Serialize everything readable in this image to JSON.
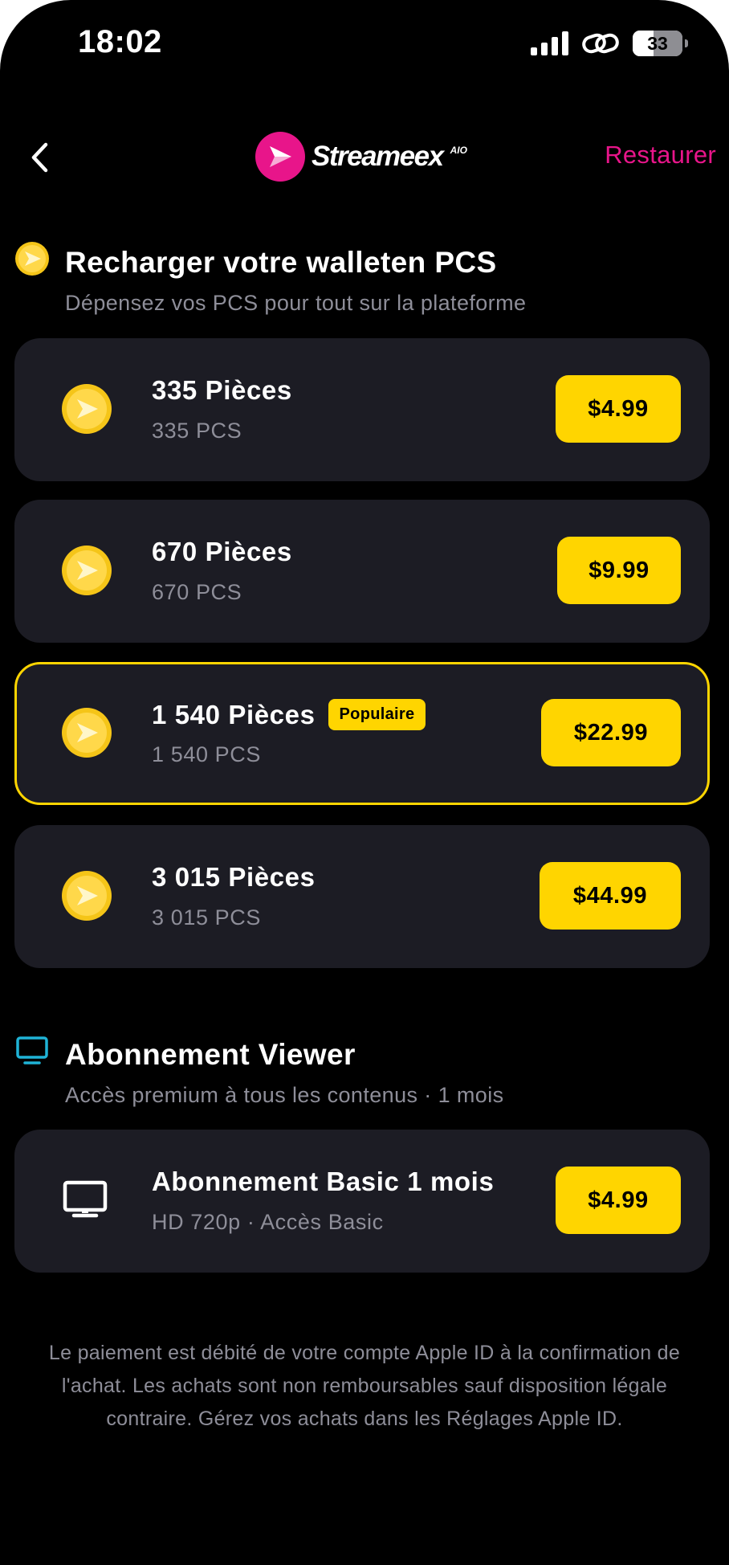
{
  "status_bar": {
    "time": "18:02",
    "battery": "33"
  },
  "nav": {
    "logo_text": "Streameex",
    "logo_suffix": "AIO",
    "restore_label": "Restaurer"
  },
  "wallet": {
    "title": "Recharger votre walleten PCS",
    "subtitle": "Dépensez vos PCS pour tout sur la plateforme",
    "packs": [
      {
        "title": "335 Pièces",
        "subtitle": "335 PCS",
        "price": "$4.99",
        "badge": ""
      },
      {
        "title": "670 Pièces",
        "subtitle": "670 PCS",
        "price": "$9.99",
        "badge": ""
      },
      {
        "title": "1 540 Pièces",
        "subtitle": "1 540 PCS",
        "price": "$22.99",
        "badge": "Populaire"
      },
      {
        "title": "3 015 Pièces",
        "subtitle": "3 015 PCS",
        "price": "$44.99",
        "badge": ""
      }
    ]
  },
  "subscription": {
    "title": "Abonnement Viewer",
    "subtitle": "Accès premium à tous les contenus · 1 mois",
    "plans": [
      {
        "title": "Abonnement Basic 1 mois",
        "subtitle": "HD 720p · Accès Basic",
        "price": "$4.99"
      }
    ]
  },
  "legal_text": "Le paiement est débité de votre compte Apple ID à la confirmation de l'achat. Les achats sont non remboursables sauf disposition légale contraire. Gérez vos achats dans les Réglages Apple ID.",
  "colors": {
    "accent_pink": "#e8158a",
    "accent_yellow": "#ffd500",
    "card_bg": "#1c1c24",
    "muted_text": "#8e8e99",
    "tv_icon_blue": "#1fb3d6"
  }
}
